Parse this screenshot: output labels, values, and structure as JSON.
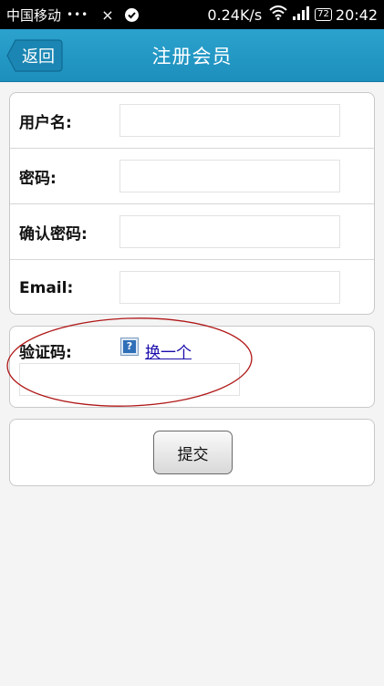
{
  "status_bar": {
    "carrier": "中国移动",
    "dots": "•••",
    "close_glyph": "×",
    "speed": "0.24K/s",
    "battery": "72",
    "time": "20:42"
  },
  "header": {
    "back_label": "返回",
    "title": "注册会员",
    "color": "#2196c4"
  },
  "form": {
    "fields": [
      {
        "label": "用户名:",
        "value": "",
        "placeholder": ""
      },
      {
        "label": "密码:",
        "value": "",
        "placeholder": ""
      },
      {
        "label": "确认密码:",
        "value": "",
        "placeholder": ""
      },
      {
        "label": "Email:",
        "value": "",
        "placeholder": ""
      }
    ],
    "captcha": {
      "label": "验证码:",
      "image_glyph": "?",
      "refresh_link": "换一个",
      "value": ""
    },
    "submit_label": "提交"
  },
  "annotation": {
    "ellipse_color": "#b01818"
  }
}
